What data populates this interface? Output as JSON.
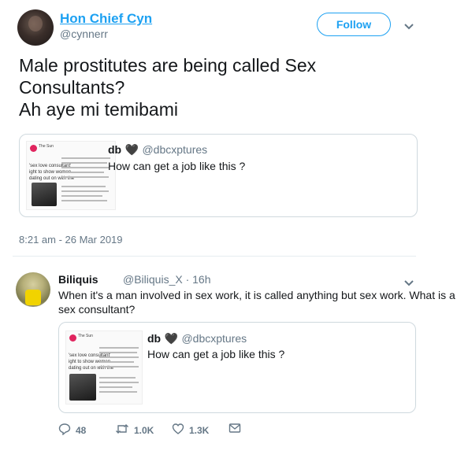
{
  "tweet": {
    "author_name": "Hon Chief Cyn",
    "author_handle": "@cynnerr",
    "follow_label": "Follow",
    "text_lines": [
      "Male prostitutes are being called Sex",
      "Consultants?",
      "Ah aye mi temibami"
    ],
    "timestamp": "8:21 am - 26 Mar 2019",
    "quoted": {
      "name": "db",
      "heart": "🖤",
      "handle": "@dbcxptures",
      "text": "How can get a job like this ?",
      "thumb": {
        "logo_text": "The Sun",
        "headline_lines": [
          "'sex love consultant'",
          "ight to show women",
          "dating out on with the"
        ]
      }
    }
  },
  "reply": {
    "author_name": "Biliquis",
    "author_handle": "@Biliquis_X",
    "separator": "·",
    "age": "16h",
    "text_lines": [
      "When it's a man involved in sex work, it is called anything but sex work. What is a",
      "sex consultant?"
    ],
    "quoted": {
      "name": "db",
      "heart": "🖤",
      "handle": "@dbcxptures",
      "text": "How can get a job like this ?"
    },
    "actions": {
      "replies": "48",
      "retweets": "1.0K",
      "likes": "1.3K"
    }
  },
  "icons": {
    "chevron": "chevron-down-icon",
    "reply": "reply-icon",
    "retweet": "retweet-icon",
    "like": "heart-icon",
    "dm": "mail-icon"
  },
  "colors": {
    "accent": "#1da1f2",
    "muted": "#657786",
    "text": "#14171a",
    "border": "#cfd9de"
  }
}
